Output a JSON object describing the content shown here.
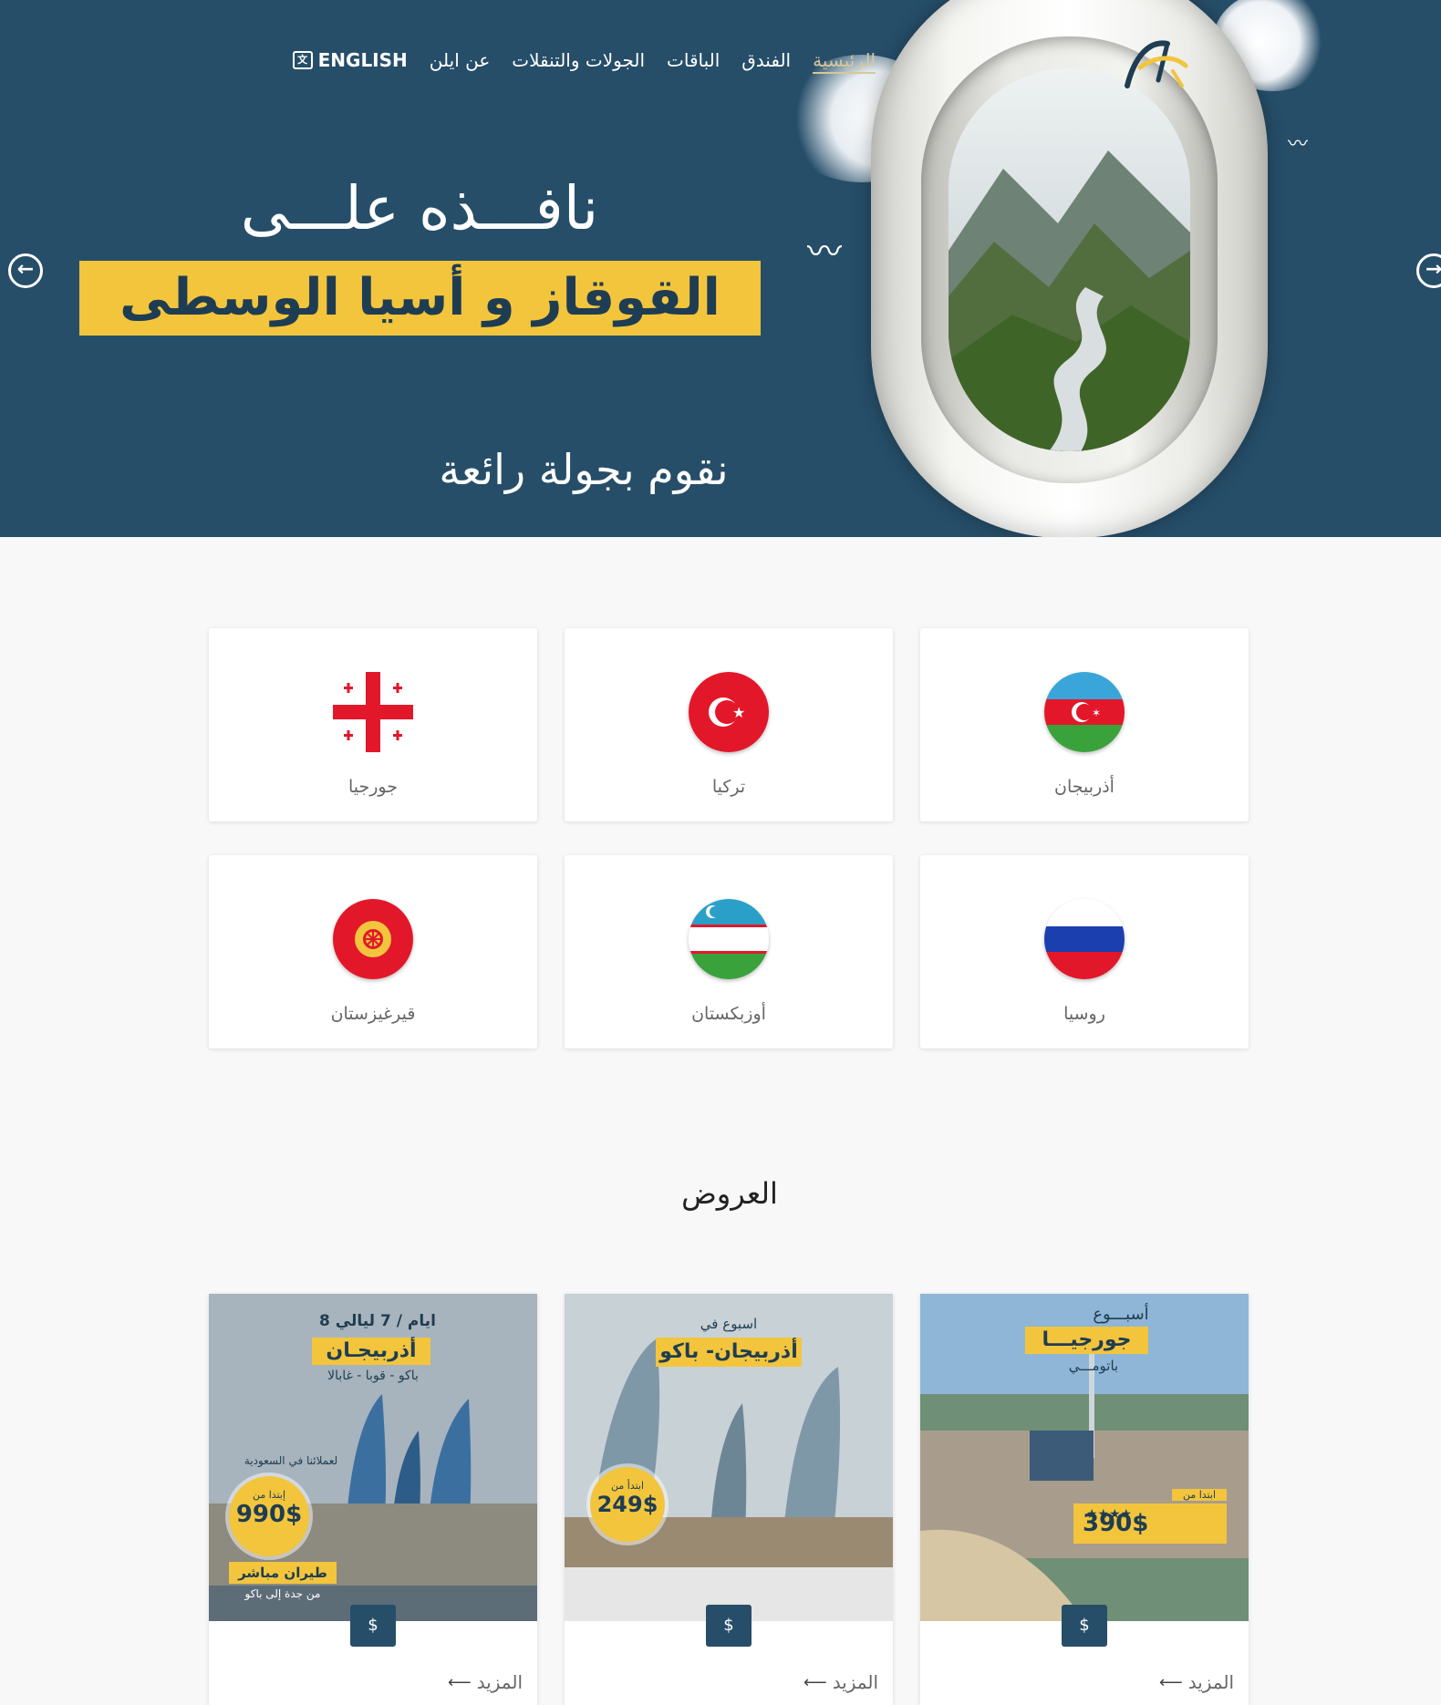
{
  "nav": {
    "items": [
      "الرئيسية",
      "الفندق",
      "الباقات",
      "الجولات والتنقلات",
      "عن ايلن"
    ],
    "language": "ENGLISH"
  },
  "hero": {
    "title_line1": "نافـــذه علـــى",
    "title_line2": "القوقاز و أسيا الوسطى",
    "subtitle": "نقوم بجولة رائعة"
  },
  "countries": [
    {
      "name": "أذربيجان",
      "flag": "azerbaijan"
    },
    {
      "name": "تركيا",
      "flag": "turkey"
    },
    {
      "name": "جورجيا",
      "flag": "georgia"
    },
    {
      "name": "روسيا",
      "flag": "russia"
    },
    {
      "name": "أوزبكستان",
      "flag": "uzbekistan"
    },
    {
      "name": "قيرغيزستان",
      "flag": "kyrgyzstan"
    }
  ],
  "offers": {
    "title": "العروض",
    "price_button": "$",
    "more_label": "المزيد",
    "cards": [
      {
        "kicker": "أسبـــوع",
        "headline": "جورجيـــا",
        "sub": "باتومـــي",
        "price_prefix": "ابتدا من",
        "price": "390$",
        "stars": "★★★★"
      },
      {
        "kicker": "اسبوع في",
        "headline": "أذربيجان- باكو",
        "price_prefix": "ابتدأ من",
        "price": "249$"
      },
      {
        "kicker": "8 ايام / 7 ليالي",
        "headline": "أذربيجـان",
        "sub": "باكو - قوبا - غابالا",
        "note": "لعملائنا في السعودية",
        "price_prefix": "إبتدا من",
        "price": "990$",
        "flight": "طيران مباشر",
        "route": "من جدة إلى باكو"
      }
    ]
  },
  "colors": {
    "hero_bg": "#264e69",
    "accent_yellow": "#f2c53d",
    "nav_active": "#d7c79a"
  }
}
